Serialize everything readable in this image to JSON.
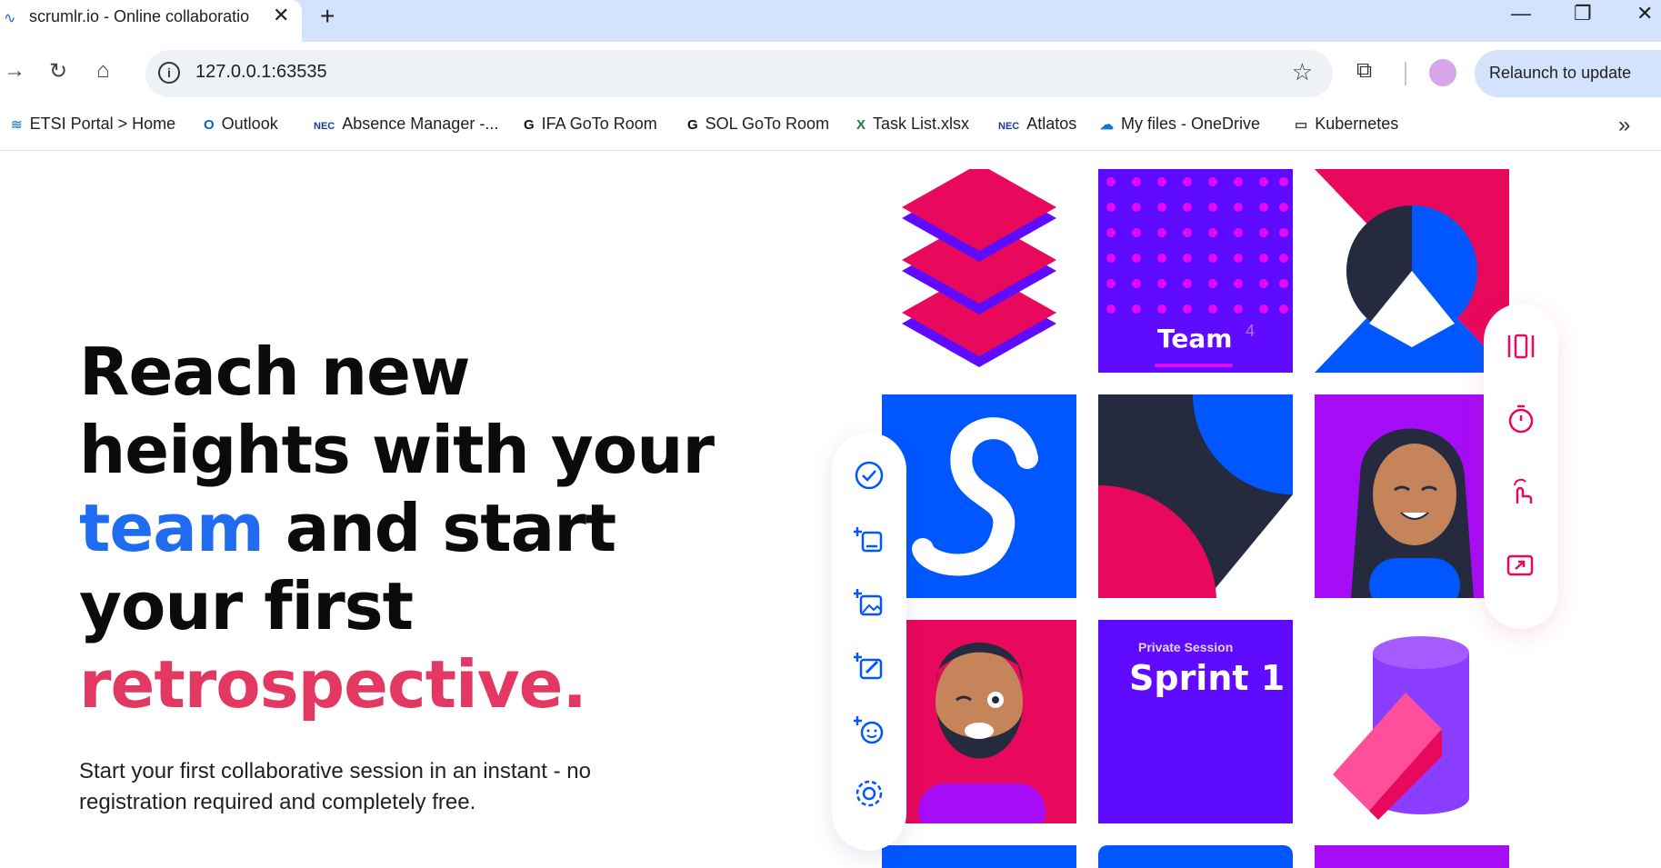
{
  "browser": {
    "tab_title": "scrumlr.io - Online collaboratio",
    "url": "127.0.0.1:63535",
    "relaunch_label": "Relaunch to update",
    "bookmarks": [
      "ETSI Portal > Home",
      "Outlook",
      "Absence Manager -...",
      "IFA GoTo Room",
      "SOL GoTo Room",
      "Task List.xlsx",
      "Atlatos",
      "My files - OneDrive",
      "Kubernetes"
    ]
  },
  "hero": {
    "line1": "Reach new",
    "line2": "heights with your",
    "word_team": "team",
    "line3_rest": " and start",
    "line4": "your first",
    "line5": "retrospective.",
    "subtitle": "Start your first collaborative session in an instant - no registration required and completely free."
  },
  "tiles": {
    "team_label": "Team",
    "team_count": "4",
    "private_session": "Private Session",
    "sprint": "Sprint 1"
  },
  "colors": {
    "brand_blue": "#0057ff",
    "brand_purple": "#5f0bff",
    "brand_pink": "#e8095c",
    "accent_violet": "#a70cf6"
  }
}
